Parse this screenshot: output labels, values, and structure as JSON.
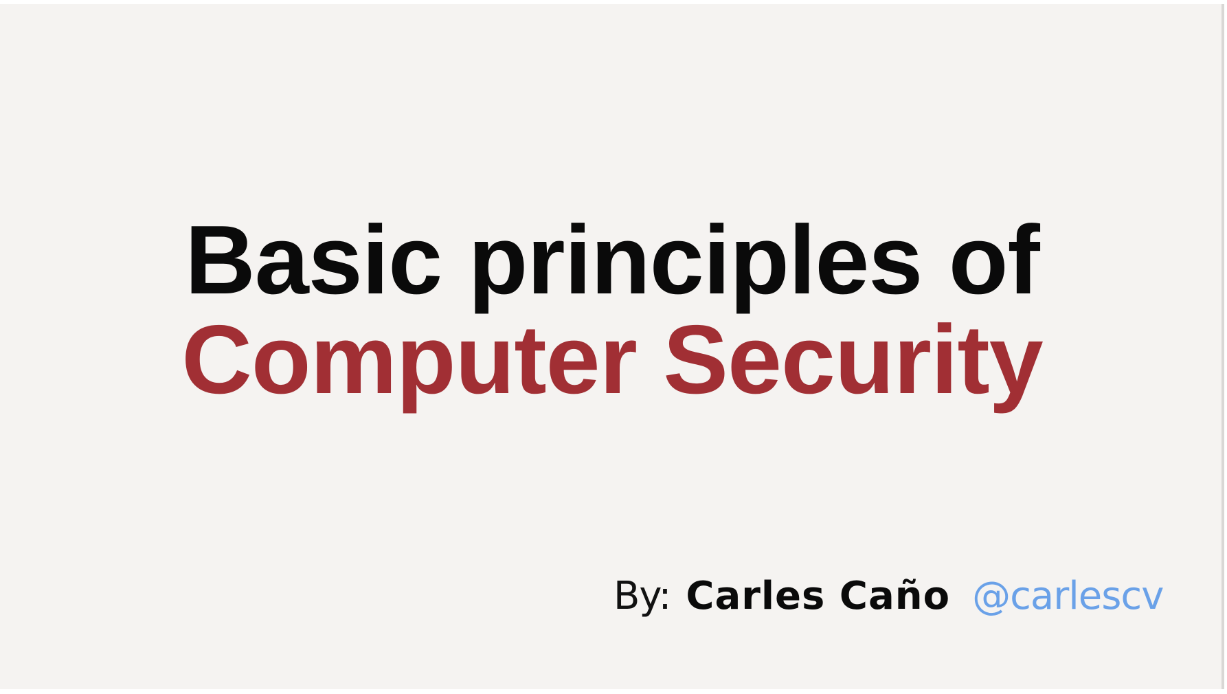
{
  "slide": {
    "title_line1": "Basic principles of",
    "title_line2": "Computer Security",
    "byline": {
      "prefix": "By:",
      "author": "Carles Caño",
      "handle": "@carlescv"
    }
  },
  "colors": {
    "background": "#f5f3f1",
    "title_dark": "#0a0a0a",
    "title_accent": "#a12f34",
    "handle_link": "#6aa1e8"
  }
}
